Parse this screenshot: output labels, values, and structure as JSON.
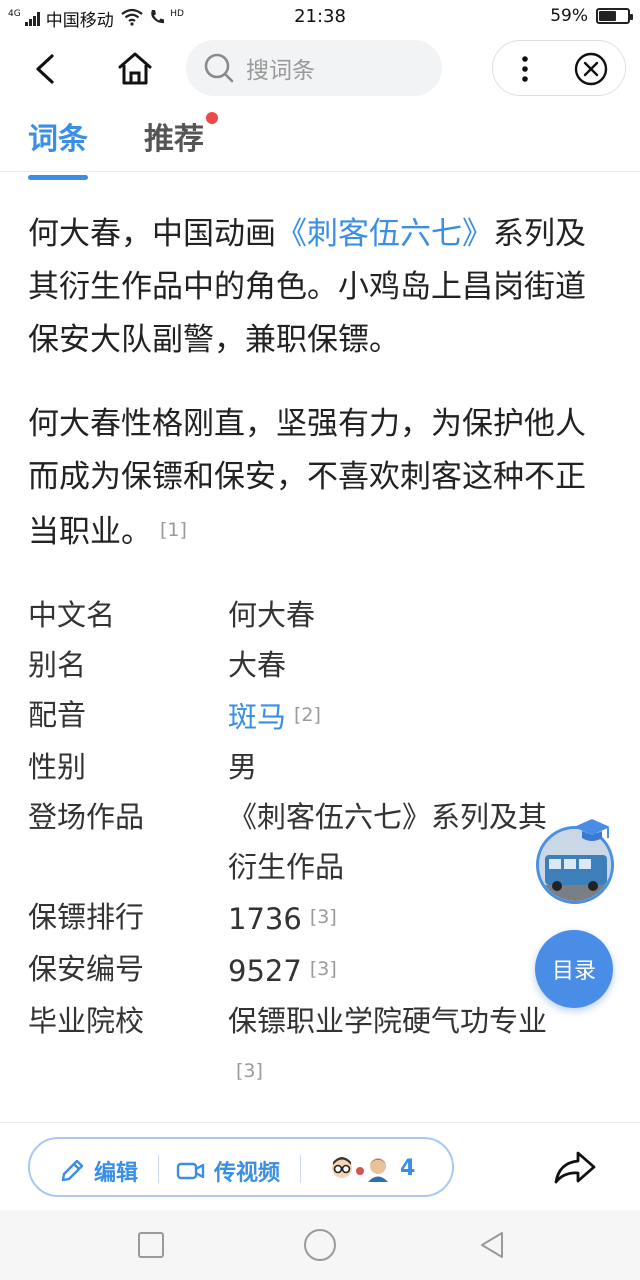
{
  "status_bar": {
    "network_tag": "4G",
    "carrier": "中国移动",
    "hd_tag": "HD",
    "time": "21:38",
    "battery_percent": "59%",
    "battery_level": 0.59
  },
  "nav": {
    "search_placeholder": "搜词条"
  },
  "tabs": [
    {
      "label": "词条",
      "active": true
    },
    {
      "label": "推荐",
      "active": false,
      "has_dot": true
    }
  ],
  "article": {
    "p1_a": "何大春，中国动画",
    "p1_link": "《刺客伍六七》",
    "p1_b": "系列及其衍生作品中的角色。小鸡岛上昌岗街道保安大队副警，兼职保镖。",
    "p2": "何大春性格刚直，坚强有力，为保护他人而成为保镖和保安，不喜欢刺客这种不正当职业。",
    "p2_ref": "[1]"
  },
  "info_box": [
    {
      "key": "中文名",
      "value": "何大春"
    },
    {
      "key": "别名",
      "value": "大春"
    },
    {
      "key": "配音",
      "value": "斑马",
      "link": true,
      "ref": "[2]"
    },
    {
      "key": "性别",
      "value": "男"
    },
    {
      "key": "登场作品",
      "value": "《刺客伍六七》系列及其衍生作品"
    },
    {
      "key": "保镖排行",
      "value": "1736",
      "ref": "[3]"
    },
    {
      "key": "保安编号",
      "value": "9527",
      "ref": "[3]"
    },
    {
      "key": "毕业院校",
      "value": "保镖职业学院硬气功专业",
      "ref": "[3]"
    }
  ],
  "floating": {
    "toc_label": "目录"
  },
  "toolbar": {
    "edit_label": "编辑",
    "video_label": "传视频",
    "contributors_count": "4"
  },
  "colors": {
    "accent": "#3a8ee6",
    "dot": "#f04848"
  }
}
